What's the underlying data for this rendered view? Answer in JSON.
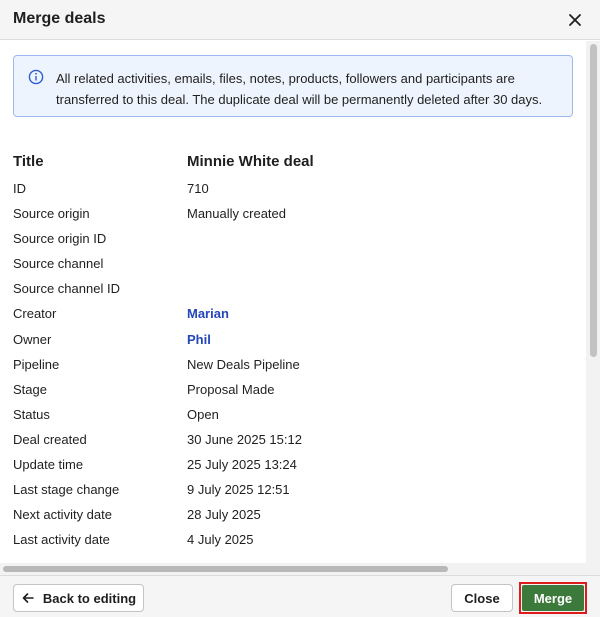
{
  "dialog": {
    "title": "Merge deals",
    "close_icon": "close-icon"
  },
  "info": {
    "icon": "info-icon",
    "text": "All related activities, emails, files, notes, products, followers and participants are transferred to this deal. The duplicate deal will be permanently deleted after 30 days."
  },
  "fields": {
    "header_label": "Title",
    "header_value": "Minnie White deal",
    "rows": [
      {
        "label": "ID",
        "value": "710"
      },
      {
        "label": "Source origin",
        "value": "Manually created"
      },
      {
        "label": "Source origin ID",
        "value": ""
      },
      {
        "label": "Source channel",
        "value": ""
      },
      {
        "label": "Source channel ID",
        "value": ""
      },
      {
        "label": "Creator",
        "value": "Marian"
      },
      {
        "label": "Owner",
        "value": "Phil"
      },
      {
        "label": "Pipeline",
        "value": "New Deals Pipeline"
      },
      {
        "label": "Stage",
        "value": "Proposal Made"
      },
      {
        "label": "Status",
        "value": "Open"
      },
      {
        "label": "Deal created",
        "value": "30 June 2025 15:12"
      },
      {
        "label": "Update time",
        "value": "25 July 2025 13:24"
      },
      {
        "label": "Last stage change",
        "value": "9 July 2025 12:51"
      },
      {
        "label": "Next activity date",
        "value": "28 July 2025"
      },
      {
        "label": "Last activity date",
        "value": "4 July 2025"
      }
    ]
  },
  "footer": {
    "back_label": "Back to editing",
    "back_icon": "arrow-left-icon",
    "close_label": "Close",
    "merge_label": "Merge"
  },
  "colors": {
    "link": "#2346b8",
    "merge_button": "#3c7a3c",
    "highlight_outline": "#e01b1b",
    "info_background": "#eef4fd",
    "info_border": "#9dbaf0"
  }
}
